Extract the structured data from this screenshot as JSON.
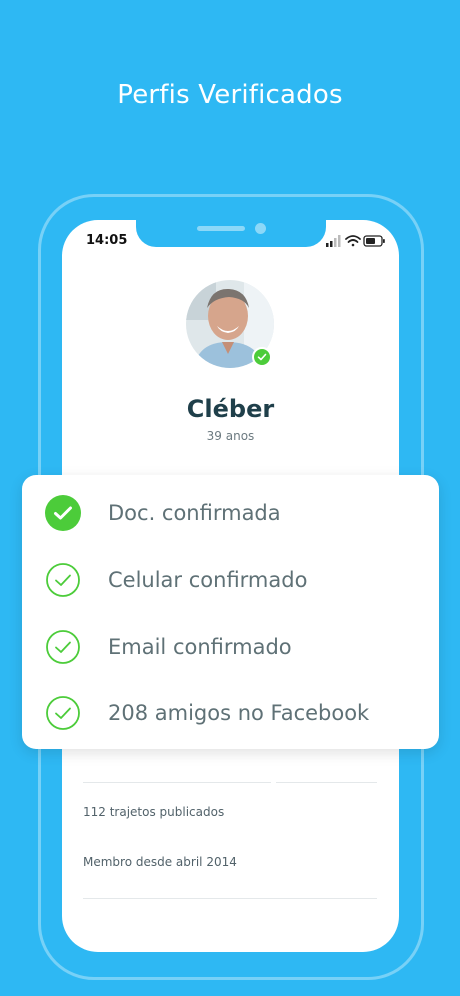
{
  "headline": "Perfis Verificados",
  "status_bar": {
    "time": "14:05",
    "icons": [
      "signal-icon",
      "wifi-icon",
      "battery-icon"
    ]
  },
  "profile": {
    "name": "Cléber",
    "age": "39 anos",
    "verified_badge_icon": "check-icon"
  },
  "verifications": [
    {
      "label": "Doc. confirmada",
      "icon": "check-filled-icon"
    },
    {
      "label": "Celular confirmado",
      "icon": "check-outline-icon"
    },
    {
      "label": "Email confirmado",
      "icon": "check-outline-icon"
    },
    {
      "label": "208 amigos no Facebook",
      "icon": "check-outline-icon"
    }
  ],
  "stats": {
    "trips": "112 trajetos publicados",
    "member_since": "Membro desde abril 2014"
  },
  "colors": {
    "background": "#2eb8f3",
    "accent_green": "#4ccc3a",
    "text_dark": "#1f3f4a",
    "text_muted": "#5f7176"
  }
}
